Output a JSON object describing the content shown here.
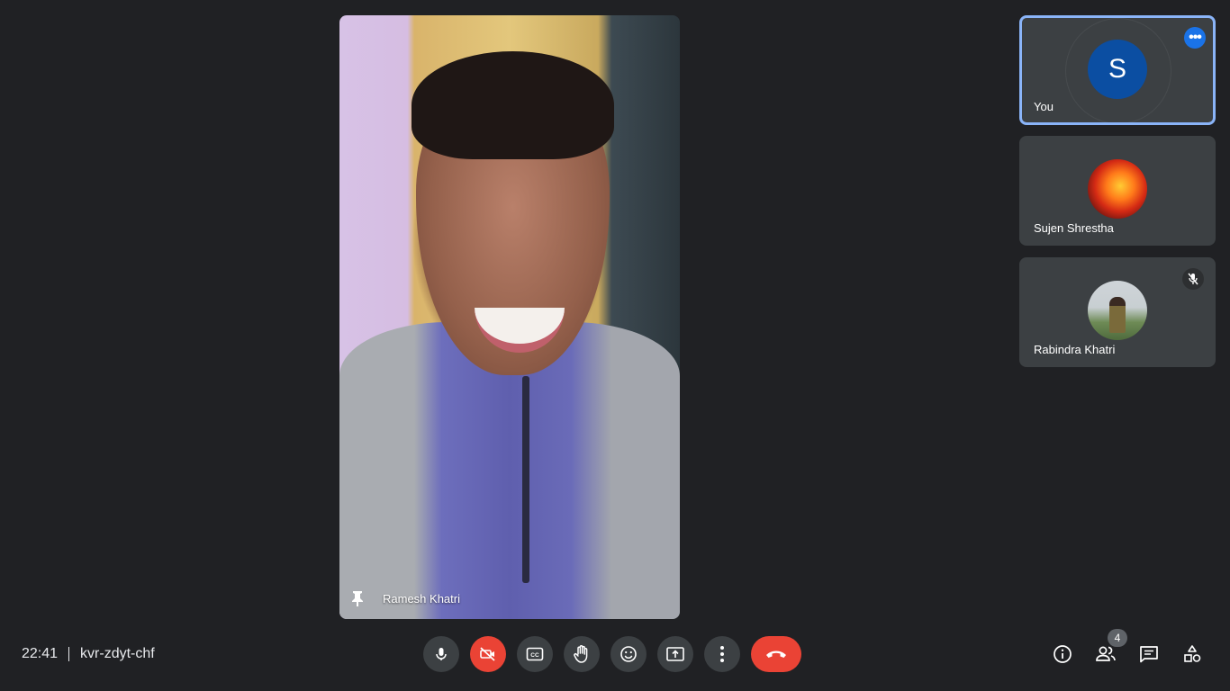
{
  "main_video": {
    "participant_name": "Ramesh Khatri",
    "pin_icon": "pin-icon"
  },
  "tiles": [
    {
      "name": "You",
      "initial": "S",
      "avatar_color": "#0b4ea2",
      "active_speaker": true,
      "menu_icon": "more-options-icon"
    },
    {
      "name": "Sujen Shrestha",
      "avatar": "fire-image"
    },
    {
      "name": "Rabindra Khatri",
      "avatar": "photo",
      "muted": true,
      "muted_icon": "mic-off-icon"
    }
  ],
  "meeting": {
    "time": "22:41",
    "code": "kvr-zdyt-chf"
  },
  "controls": [
    {
      "name": "microphone",
      "icon": "mic-icon"
    },
    {
      "name": "camera-off",
      "icon": "videocam-off-icon",
      "color": "#ea4335"
    },
    {
      "name": "captions",
      "icon": "closed-captions-icon"
    },
    {
      "name": "raise-hand",
      "icon": "hand-icon"
    },
    {
      "name": "reactions",
      "icon": "emoji-icon"
    },
    {
      "name": "present",
      "icon": "present-screen-icon"
    },
    {
      "name": "more",
      "icon": "more-vert-icon"
    },
    {
      "name": "leave-call",
      "icon": "call-end-icon",
      "color": "#ea4335"
    }
  ],
  "side_panel": {
    "people_count": "4",
    "icons": [
      "info-icon",
      "people-icon",
      "chat-icon",
      "activities-icon"
    ]
  }
}
